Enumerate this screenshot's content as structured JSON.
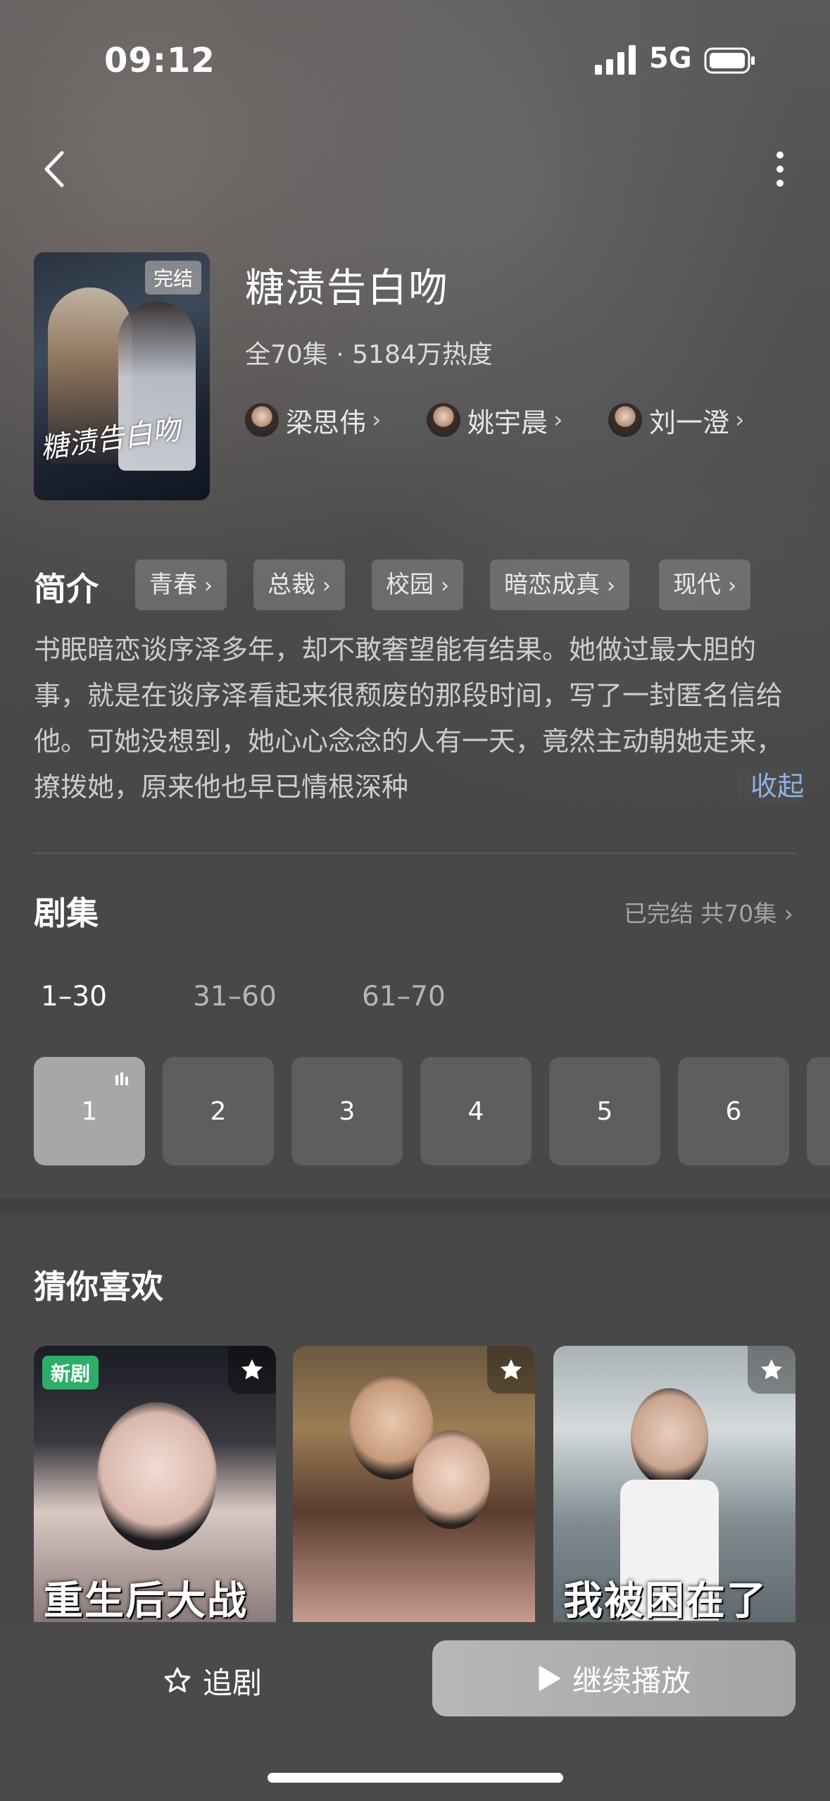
{
  "status_bar": {
    "time": "09:12",
    "network": "5G"
  },
  "drama": {
    "title": "糖渍告白吻",
    "badge": "完结",
    "poster_title": "糖渍告白吻",
    "meta": "全70集 · 5184万热度",
    "cast": [
      {
        "name": "梁思伟"
      },
      {
        "name": "姚宇晨"
      },
      {
        "name": "刘一澄"
      }
    ]
  },
  "intro": {
    "label": "简介",
    "tags": [
      "青春",
      "总裁",
      "校园",
      "暗恋成真",
      "现代"
    ],
    "text": "书眠暗恋谈序泽多年，却不敢奢望能有结果。她做过最大胆的事，就是在谈序泽看起来很颓废的那段时间，写了一封匿名信给他。可她没想到，她心心念念的人有一天，竟然主动朝她走来，撩拨她，原来他也早已情根深种",
    "collapse": "收起"
  },
  "episodes": {
    "title": "剧集",
    "status": "已完结 共70集",
    "ranges": [
      "1–30",
      "31–60",
      "61–70"
    ],
    "active_range": 0,
    "items": [
      "1",
      "2",
      "3",
      "4",
      "5",
      "6"
    ],
    "active_item": 0
  },
  "recommend": {
    "title": "猜你喜欢",
    "cards": [
      {
        "badge": "新剧",
        "caption": "重生后大战"
      },
      {
        "caption": ""
      },
      {
        "caption": "我被困在了"
      }
    ]
  },
  "actions": {
    "follow": "追剧",
    "play": "继续播放"
  }
}
